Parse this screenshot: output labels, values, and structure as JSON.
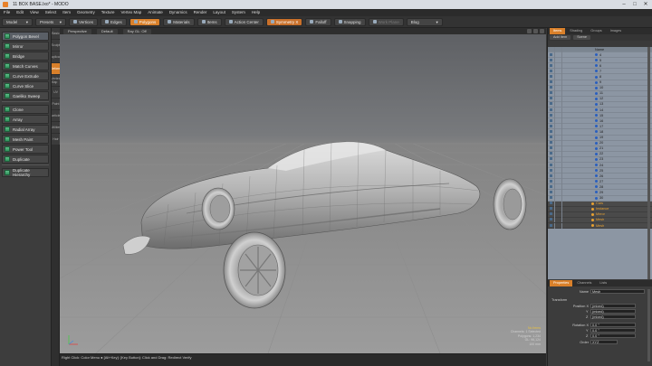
{
  "window": {
    "title": "11 BOX BASE.lxo* - MODO"
  },
  "menu": [
    "File",
    "Edit",
    "View",
    "Select",
    "Item",
    "Geometry",
    "Texture",
    "Vertex Map",
    "Animate",
    "Dynamics",
    "Render",
    "Layout",
    "System",
    "Help"
  ],
  "toolbar": {
    "layout": "Model",
    "presets": "Presets",
    "mode_vertices": "Vertices",
    "mode_edges": "Edges",
    "mode_polygons": "Polygons",
    "mode_materials": "Materials",
    "mode_items": "Items",
    "action_center": "Action Center",
    "symmetry": "Symmetry X",
    "falloff": "Falloff",
    "snapping": "Snapping",
    "work_plane": "Work Plane",
    "render_menu": "Blog"
  },
  "tools": [
    "Polygon Bevel",
    "Mirror",
    "Bridge",
    "Match Curves",
    "Curve Extrude",
    "Curve Slice",
    "Gaeliko Sweep",
    "Clone",
    "Array",
    "Radial Array",
    "Mesh Paint",
    "Power Tool",
    "Duplicate",
    "Duplicate Hierarchy"
  ],
  "vertical_tabs": [
    "Basic",
    "Sculpt",
    "Duplicate",
    "Deform",
    "Vertex Map",
    "UV",
    "Paint",
    "Particles",
    "Utilities",
    "Hair"
  ],
  "viewport": {
    "header": [
      "Perspective",
      "Default",
      "Ray GL: Off"
    ],
    "info": [
      {
        "text": "No Items",
        "highlight": true
      },
      {
        "text": "Channels: 1 Selected",
        "highlight": false
      },
      {
        "text": "Polygons: 1,234",
        "highlight": false
      },
      {
        "text": "GL: 96,124",
        "highlight": false
      },
      {
        "text": "100 mm",
        "highlight": false
      }
    ]
  },
  "status": {
    "text": "Right Click: Color Menu ● [Alt+Key]: [Key Button]: Click and Drag: Redirect Verify"
  },
  "right": {
    "tabs": [
      "Items",
      "Shading",
      "Groups",
      "Images"
    ],
    "header_buttons": [
      "Add Item",
      "Scene"
    ],
    "column": "Name",
    "mesh_items": [
      "4",
      "5",
      "6",
      "7",
      "8",
      "9",
      "10",
      "11",
      "12",
      "13",
      "14",
      "15",
      "16",
      "17",
      "18",
      "19",
      "20",
      "21",
      "22",
      "23",
      "24",
      "25",
      "26",
      "27",
      "28",
      "29",
      "30"
    ],
    "dark_items": [
      {
        "name": "Cars",
        "kind": "group"
      },
      {
        "name": "Instance",
        "kind": "light"
      },
      {
        "name": "Mirror",
        "kind": "light"
      },
      {
        "name": "Mesh",
        "kind": "light"
      },
      {
        "name": "Mesh",
        "kind": "light"
      }
    ],
    "properties": {
      "tabs": [
        "Properties",
        "Channels",
        "Lists"
      ],
      "name_label": "Name",
      "name_value": "Mesh",
      "section": "Transform",
      "position_label": "Position X",
      "pos": [
        "(mixed)",
        "(mixed)",
        "(mixed)"
      ],
      "rotation_label": "Rotation X",
      "rot": [
        "0.0 °",
        "0.0 °",
        "0.0 °"
      ],
      "order_label": "Order",
      "order": "XYZ",
      "y": "Y",
      "z": "Z"
    }
  },
  "colors": {
    "accent": "#d9802a",
    "outliner": "#8c96a3",
    "tool_icon": "#3fa86c"
  }
}
